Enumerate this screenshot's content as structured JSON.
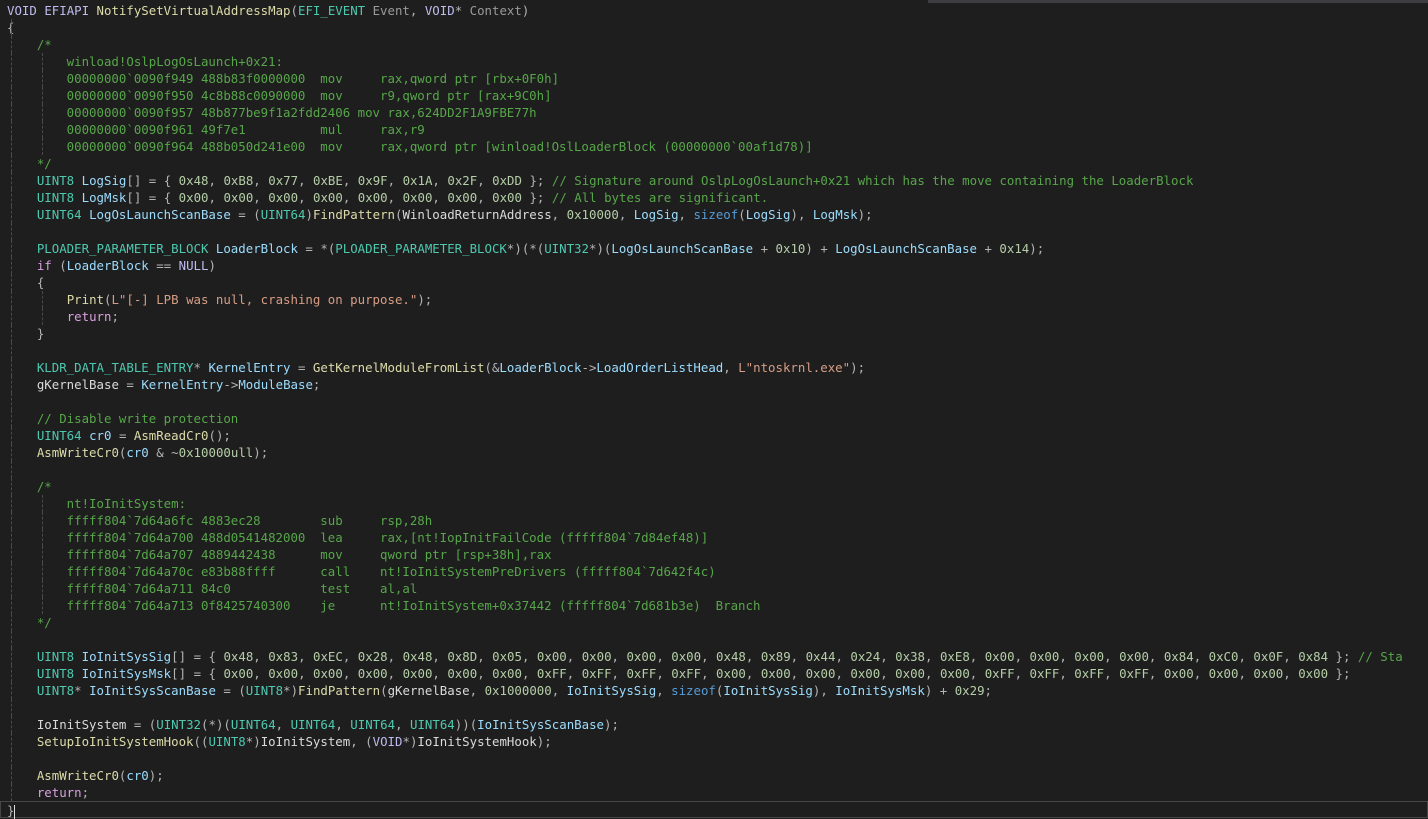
{
  "editor": {
    "theme": "dark",
    "colors": {
      "background": "#1e1e1e",
      "keyword": "#569cd6",
      "control_keyword": "#d8a0df",
      "type": "#4ec9b0",
      "function": "#dcdcaa",
      "variable": "#9cdcfe",
      "number": "#b5cea8",
      "string": "#d69d85",
      "comment": "#57a64a"
    },
    "function_signature": {
      "return_type": "VOID",
      "calling_convention": "EFIAPI",
      "name": "NotifySetVirtualAddressMap",
      "param1_type": "EFI_EVENT",
      "param1_name": "Event",
      "param2_type": "VOID",
      "param2_name": "Context"
    },
    "lines": [
      "VOID EFIAPI NotifySetVirtualAddressMap(EFI_EVENT Event, VOID* Context)",
      "{",
      "    /*",
      "        winload!OslpLogOsLaunch+0x21:",
      "        00000000`0090f949 488b83f0000000  mov     rax,qword ptr [rbx+0F0h]",
      "        00000000`0090f950 4c8b88c0090000  mov     r9,qword ptr [rax+9C0h]",
      "        00000000`0090f957 48b877be9f1a2fdd2406 mov rax,624DD2F1A9FBE77h",
      "        00000000`0090f961 49f7e1          mul     rax,r9",
      "        00000000`0090f964 488b050d241e00  mov     rax,qword ptr [winload!OslLoaderBlock (00000000`00af1d78)]",
      "    */",
      "    UINT8 LogSig[] = { 0x48, 0xB8, 0x77, 0xBE, 0x9F, 0x1A, 0x2F, 0xDD }; // Signature around OslpLogOsLaunch+0x21 which has the move containing the LoaderBlock",
      "    UINT8 LogMsk[] = { 0x00, 0x00, 0x00, 0x00, 0x00, 0x00, 0x00, 0x00 }; // All bytes are significant.",
      "    UINT64 LogOsLaunchScanBase = (UINT64)FindPattern(WinloadReturnAddress, 0x10000, LogSig, sizeof(LogSig), LogMsk);",
      "",
      "    PLOADER_PARAMETER_BLOCK LoaderBlock = *(PLOADER_PARAMETER_BLOCK*)(*(UINT32*)(LogOsLaunchScanBase + 0x10) + LogOsLaunchScanBase + 0x14);",
      "    if (LoaderBlock == NULL)",
      "    {",
      "        Print(L\"[-] LPB was null, crashing on purpose.\");",
      "        return;",
      "    }",
      "",
      "    KLDR_DATA_TABLE_ENTRY* KernelEntry = GetKernelModuleFromList(&LoaderBlock->LoadOrderListHead, L\"ntoskrnl.exe\");",
      "    gKernelBase = KernelEntry->ModuleBase;",
      "",
      "    // Disable write protection",
      "    UINT64 cr0 = AsmReadCr0();",
      "    AsmWriteCr0(cr0 & ~0x10000ull);",
      "",
      "    /*",
      "        nt!IoInitSystem:",
      "        fffff804`7d64a6fc 4883ec28        sub     rsp,28h",
      "        fffff804`7d64a700 488d0541482000  lea     rax,[nt!IopInitFailCode (fffff804`7d84ef48)]",
      "        fffff804`7d64a707 4889442438      mov     qword ptr [rsp+38h],rax",
      "        fffff804`7d64a70c e83b88ffff      call    nt!IoInitSystemPreDrivers (fffff804`7d642f4c)",
      "        fffff804`7d64a711 84c0            test    al,al",
      "        fffff804`7d64a713 0f8425740300    je      nt!IoInitSystem+0x37442 (fffff804`7d681b3e)  Branch",
      "    */",
      "",
      "    UINT8 IoInitSysSig[] = { 0x48, 0x83, 0xEC, 0x28, 0x48, 0x8D, 0x05, 0x00, 0x00, 0x00, 0x00, 0x48, 0x89, 0x44, 0x24, 0x38, 0xE8, 0x00, 0x00, 0x00, 0x00, 0x84, 0xC0, 0x0F, 0x84 }; // Sta",
      "    UINT8 IoInitSysMsk[] = { 0x00, 0x00, 0x00, 0x00, 0x00, 0x00, 0x00, 0xFF, 0xFF, 0xFF, 0xFF, 0x00, 0x00, 0x00, 0x00, 0x00, 0x00, 0xFF, 0xFF, 0xFF, 0xFF, 0x00, 0x00, 0x00, 0x00 };",
      "    UINT8* IoInitSysScanBase = (UINT8*)FindPattern(gKernelBase, 0x1000000, IoInitSysSig, sizeof(IoInitSysSig), IoInitSysMsk) + 0x29;",
      "",
      "    IoInitSystem = (UINT32(*)(UINT64, UINT64, UINT64, UINT64))(IoInitSysScanBase);",
      "    SetupIoInitSystemHook((UINT8*)IoInitSystem, (VOID*)IoInitSystemHook);",
      "",
      "    AsmWriteCr0(cr0);",
      "    return;",
      "}"
    ]
  }
}
